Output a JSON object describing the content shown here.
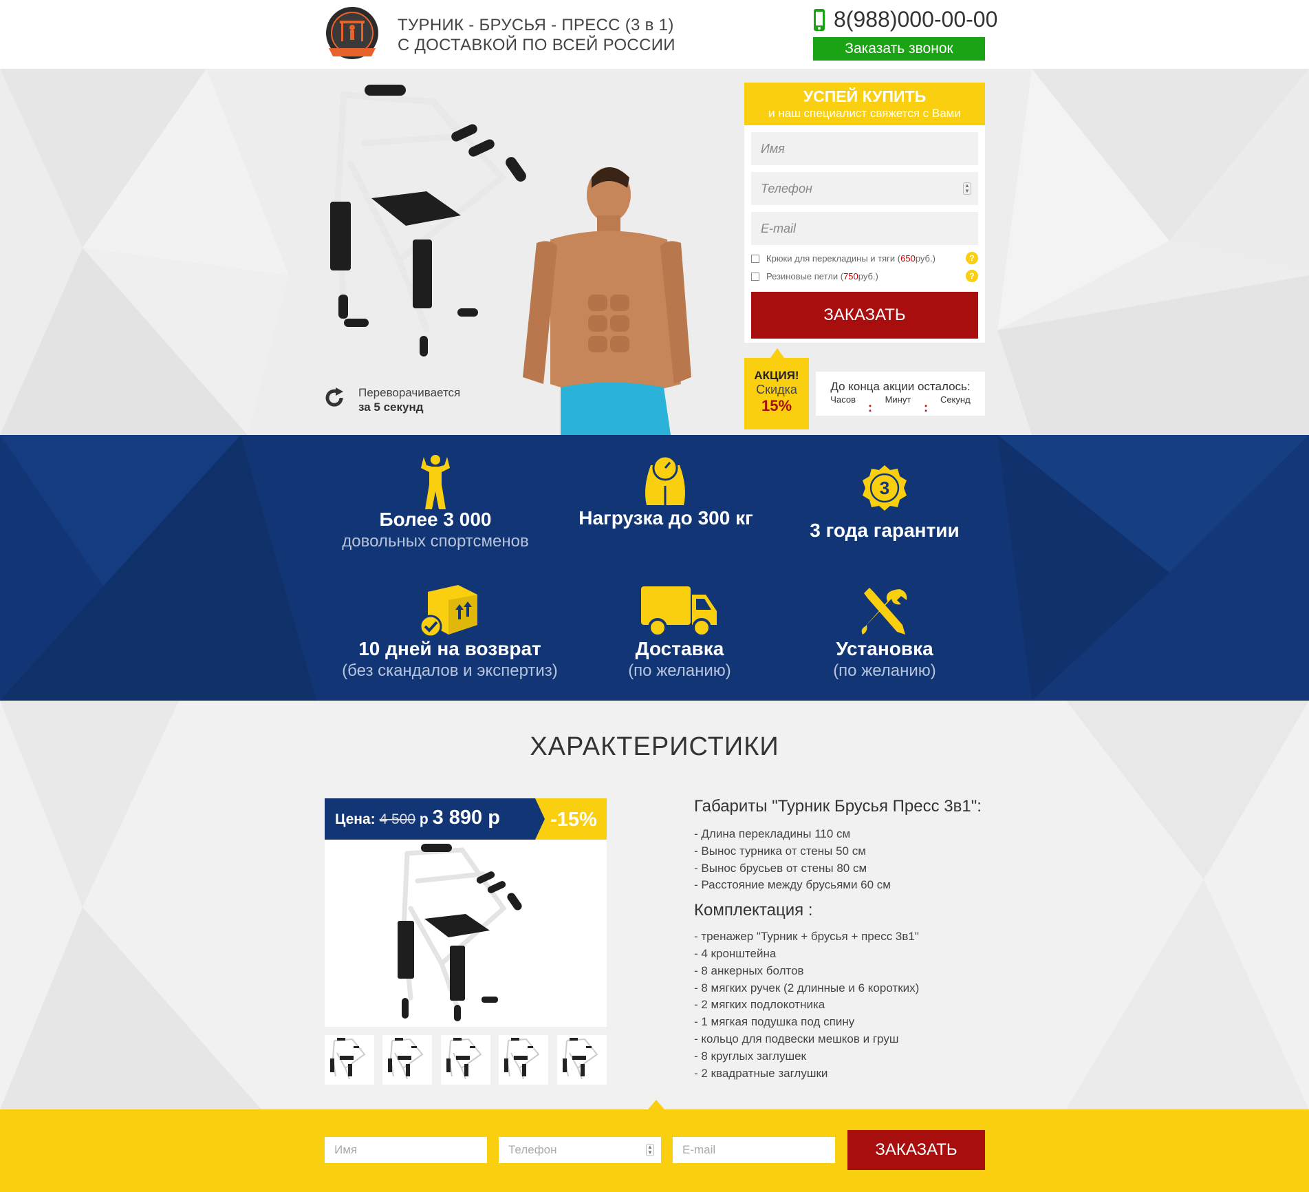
{
  "header": {
    "title_line1": "ТУРНИК - БРУСЬЯ - ПРЕСС (3 в 1)",
    "title_line2": "С ДОСТАВКОЙ ПО ВСЕЙ РОССИИ",
    "phone": "8(988)000-00-00",
    "callback_label": "Заказать звонок"
  },
  "hero": {
    "flip_line1": "Переворачивается",
    "flip_line2": "за 5 секунд"
  },
  "form": {
    "head_title": "УСПЕЙ КУПИТЬ",
    "head_subtitle": "и наш специалист свяжется с Вами",
    "name_placeholder": "Имя",
    "phone_placeholder": "Телефон",
    "email_placeholder": "E-mail",
    "option1_text": "Крюки для перекладины и тяги (",
    "option1_price": "650",
    "option1_suffix": " руб.)",
    "option2_text": "Резиновые петли (",
    "option2_price": "750",
    "option2_suffix": " руб.)",
    "help_glyph": "?",
    "order_label": "ЗАКАЗАТЬ"
  },
  "promo": {
    "line1": "АКЦИЯ!",
    "line2": "Скидка",
    "line3": "15%",
    "timer_label": "До конца акции осталось:",
    "unit_hours": "Часов",
    "unit_minutes": "Минут",
    "unit_seconds": "Секунд",
    "separator": ":"
  },
  "features": [
    {
      "title": "Более 3 000",
      "sub": "довольных спортсменов",
      "icon": "athlete-icon"
    },
    {
      "title": "Нагрузка до 300 кг",
      "sub": "",
      "icon": "weight-icon"
    },
    {
      "title": "3 года гарантии",
      "sub": "",
      "icon": "warranty-badge-icon",
      "badge": "3"
    },
    {
      "title": "10 дней на возврат",
      "sub": "(без скандалов и экспертиз)",
      "icon": "return-box-icon"
    },
    {
      "title": "Доставка",
      "sub": "(по желанию)",
      "icon": "delivery-truck-icon"
    },
    {
      "title": "Установка",
      "sub": "(по желанию)",
      "icon": "tools-icon"
    }
  ],
  "specs": {
    "title": "ХАРАКТЕРИСТИКИ",
    "price_label": "Цена:",
    "old_price": "4 500",
    "old_unit": " р",
    "current_price": "3 890 р",
    "discount": "-15%",
    "dims_heading": "Габариты \"Турник Брусья Пресс 3в1\":",
    "dims": [
      "- Длина перекладины 110 см",
      "- Вынос турника от стены 50 см",
      "- Вынос брусьев от стены 80 см",
      "- Расстояние между брусьями 60 см"
    ],
    "kit_heading": "Комплектация :",
    "kit": [
      "- тренажер \"Турник + брусья + пресс 3в1\"",
      "- 4 кронштейна",
      "- 8 анкерных болтов",
      "- 8 мягких ручек (2 длинные и 6 коротких)",
      "- 2 мягких подлокотника",
      "- 1 мягкая подушка под спину",
      "- кольцо для подвески мешков и груш",
      "- 8 круглых заглушек",
      "- 2 квадратные заглушки"
    ]
  },
  "bottom_form": {
    "name_placeholder": "Имя",
    "phone_placeholder": "Телефон",
    "email_placeholder": "E-mail",
    "order_label": "ЗАКАЗАТЬ"
  },
  "colors": {
    "yellow": "#f9cf10",
    "navy": "#123675",
    "red": "#a90e0e",
    "green": "#1aa314"
  }
}
